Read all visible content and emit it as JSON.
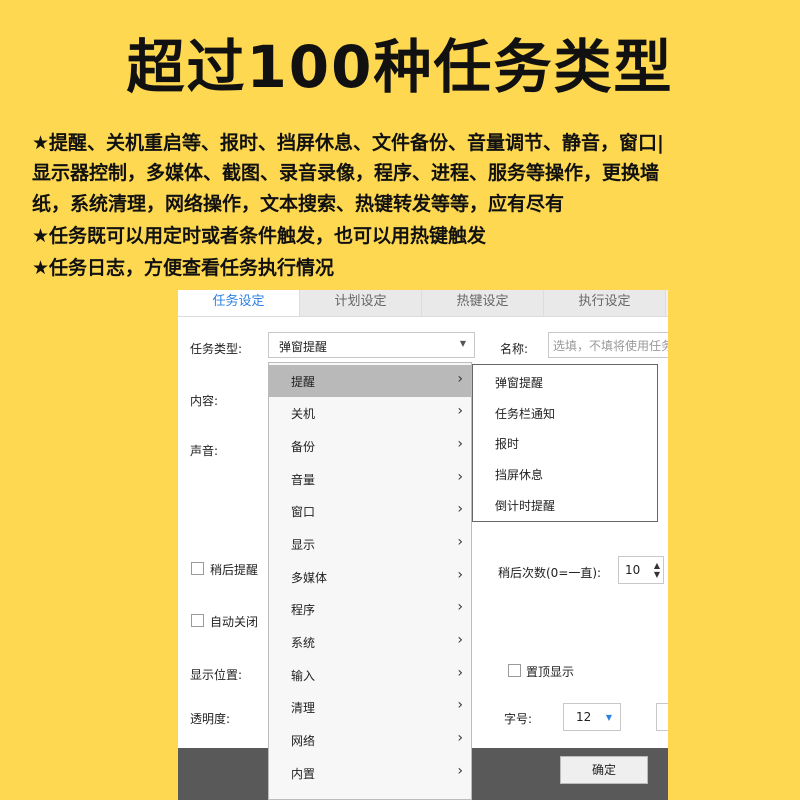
{
  "headline": "超过100种任务类型",
  "features": [
    "★提醒、关机重启等、报时、挡屏休息、文件备份、音量调节、静音，窗口|",
    "显示器控制，多媒体、截图、录音录像，程序、进程、服务等操作，更换墙",
    "纸，系统清理，网络操作，文本搜索、热键转发等等，应有尽有",
    "★任务既可以用定时或者条件触发，也可以用热键触发",
    "★任务日志，方便查看任务执行情况"
  ],
  "tabs": [
    "任务设定",
    "计划设定",
    "热键设定",
    "执行设定"
  ],
  "form": {
    "task_type_label": "任务类型:",
    "task_type_value": "弹窗提醒",
    "name_label": "名称:",
    "name_placeholder": "选填，不填将使用任务",
    "content_label": "内容:",
    "sound_label": "声音:",
    "snooze_label": "稍后提醒",
    "auto_close_label": "自动关闭",
    "snooze_count_label": "稍后次数(0=一直):",
    "snooze_count_value": "10",
    "position_label": "显示位置:",
    "on_top_label": "置顶显示",
    "opacity_label": "透明度:",
    "font_size_label": "字号:",
    "font_size_value": "12"
  },
  "ok_button": "确定",
  "menu_items": [
    "提醒",
    "关机",
    "备份",
    "音量",
    "窗口",
    "显示",
    "多媒体",
    "程序",
    "系统",
    "输入",
    "清理",
    "网络",
    "内置"
  ],
  "submenu_items": [
    "弹窗提醒",
    "任务栏通知",
    "报时",
    "挡屏休息",
    "倒计时提醒"
  ],
  "colors": {
    "background": "#fed851",
    "active_tab": "#2a82e4",
    "menu_highlight": "#b9b9b9",
    "footer": "#595959"
  },
  "icons": {
    "menu_chevron": "chevron-right-icon",
    "select_arrow": "caret-down-icon"
  }
}
